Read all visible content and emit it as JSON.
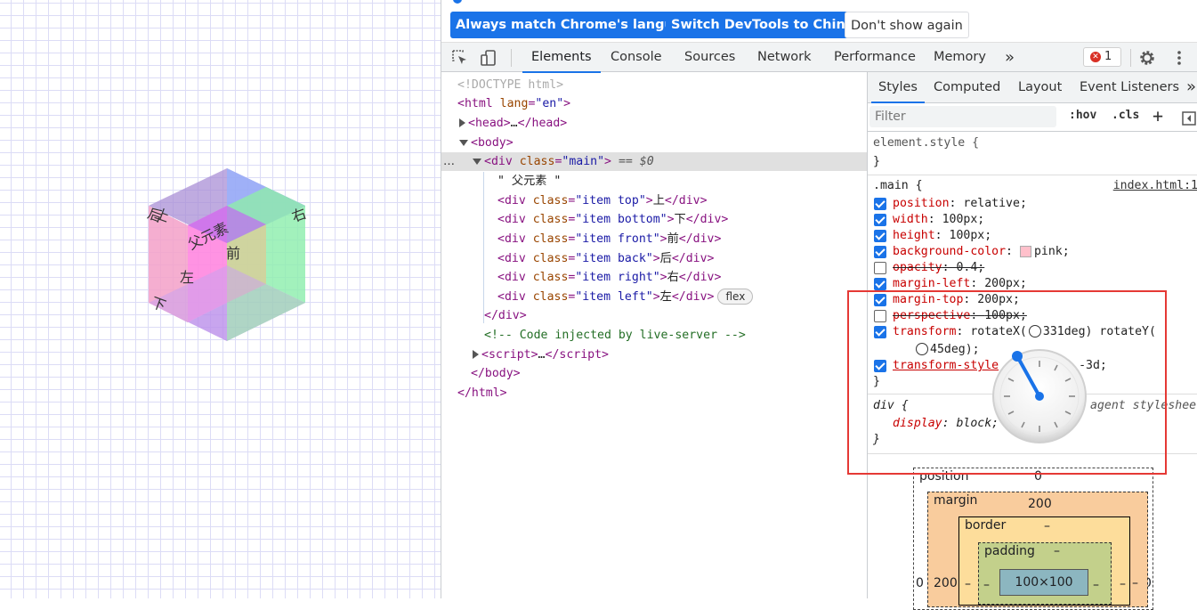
{
  "infobar": {
    "btn_match_language": "Always match Chrome's language",
    "btn_switch_chinese": "Switch DevTools to Chinese",
    "btn_dont_show": "Don't show again"
  },
  "tabs": [
    {
      "label": "Elements"
    },
    {
      "label": "Console"
    },
    {
      "label": "Sources"
    },
    {
      "label": "Network"
    },
    {
      "label": "Performance"
    },
    {
      "label": "Memory"
    }
  ],
  "more_tabs": "»",
  "error_count": "1",
  "icons": {
    "inspect": "inspect-element-icon",
    "device": "device-toolbar-icon",
    "settings": "gear-icon",
    "menu": "kebab-menu-icon",
    "error": "error-x-icon"
  },
  "page": {
    "cube_faces": {
      "top": "上",
      "bottom": "下",
      "front": "前",
      "back": "后",
      "right": "右",
      "left": "左",
      "parent_text": "父元素"
    }
  },
  "dom": {
    "doctype": "<!DOCTYPE html>",
    "html_tag": "html",
    "html_attr": "lang",
    "html_val": "\"en\"",
    "head_tag": "head",
    "head_ellipsis": "…",
    "body_tag": "body",
    "div_tag": "div",
    "class_attr": "class",
    "main_val": "\"main\"",
    "eq0": "== $0",
    "parent_text": "\" 父元素 \"",
    "children": [
      {
        "cls": "\"item top\"",
        "text": "上"
      },
      {
        "cls": "\"item bottom\"",
        "text": "下"
      },
      {
        "cls": "\"item front\"",
        "text": "前"
      },
      {
        "cls": "\"item back\"",
        "text": "后"
      },
      {
        "cls": "\"item right\"",
        "text": "右"
      },
      {
        "cls": "\"item left\"",
        "text": "左"
      }
    ],
    "flex_badge": "flex",
    "comment": "<!-- Code injected by live-server -->",
    "script_tag": "script",
    "dots": "…"
  },
  "sidebar": {
    "tabs": [
      {
        "label": "Styles"
      },
      {
        "label": "Computed"
      },
      {
        "label": "Layout"
      },
      {
        "label": "Event Listeners"
      }
    ],
    "more": "»",
    "filter_placeholder": "Filter",
    "hov": ":hov",
    "cls": ".cls",
    "plus": "+",
    "element_style_sel": "element.style {",
    "close_brace": "}",
    "main_sel": ".main {",
    "main_source": "index.html:1",
    "props": [
      {
        "name": "position",
        "value": "relative;",
        "checked": true,
        "strike": false
      },
      {
        "name": "width",
        "value": "100px;",
        "checked": true,
        "strike": false
      },
      {
        "name": "height",
        "value": "100px;",
        "checked": true,
        "strike": false
      },
      {
        "name": "background-color",
        "value": "pink;",
        "checked": true,
        "strike": false
      },
      {
        "name": "opacity",
        "value": "0.4;",
        "checked": false,
        "strike": true
      },
      {
        "name": "margin-left",
        "value": "200px;",
        "checked": true,
        "strike": false
      },
      {
        "name": "margin-top",
        "value": "200px;",
        "checked": true,
        "strike": false
      },
      {
        "name": "perspective",
        "value": "100px;",
        "checked": false,
        "strike": true
      },
      {
        "name": "transform",
        "value": "rotateX(",
        "checked": true,
        "strike": false
      },
      {
        "name": "transform-style",
        "value": "-3d;",
        "checked": true,
        "strike": false
      }
    ],
    "transform_x": "331deg) rotateY(",
    "transform_y": "45deg);",
    "div_sel": "div {",
    "div_source": "agent styleshee",
    "display_name": "display",
    "display_value": "block;",
    "box_model": {
      "position_label": "position",
      "position_value": "0",
      "margin_label": "margin",
      "margin_value": "200",
      "margin_left": "200",
      "border_label": "border",
      "border_value": "–",
      "padding_label": "padding",
      "padding_value": "–",
      "content": "100×100",
      "outer_left": "0",
      "outer_right": "0",
      "dash": "–"
    }
  }
}
